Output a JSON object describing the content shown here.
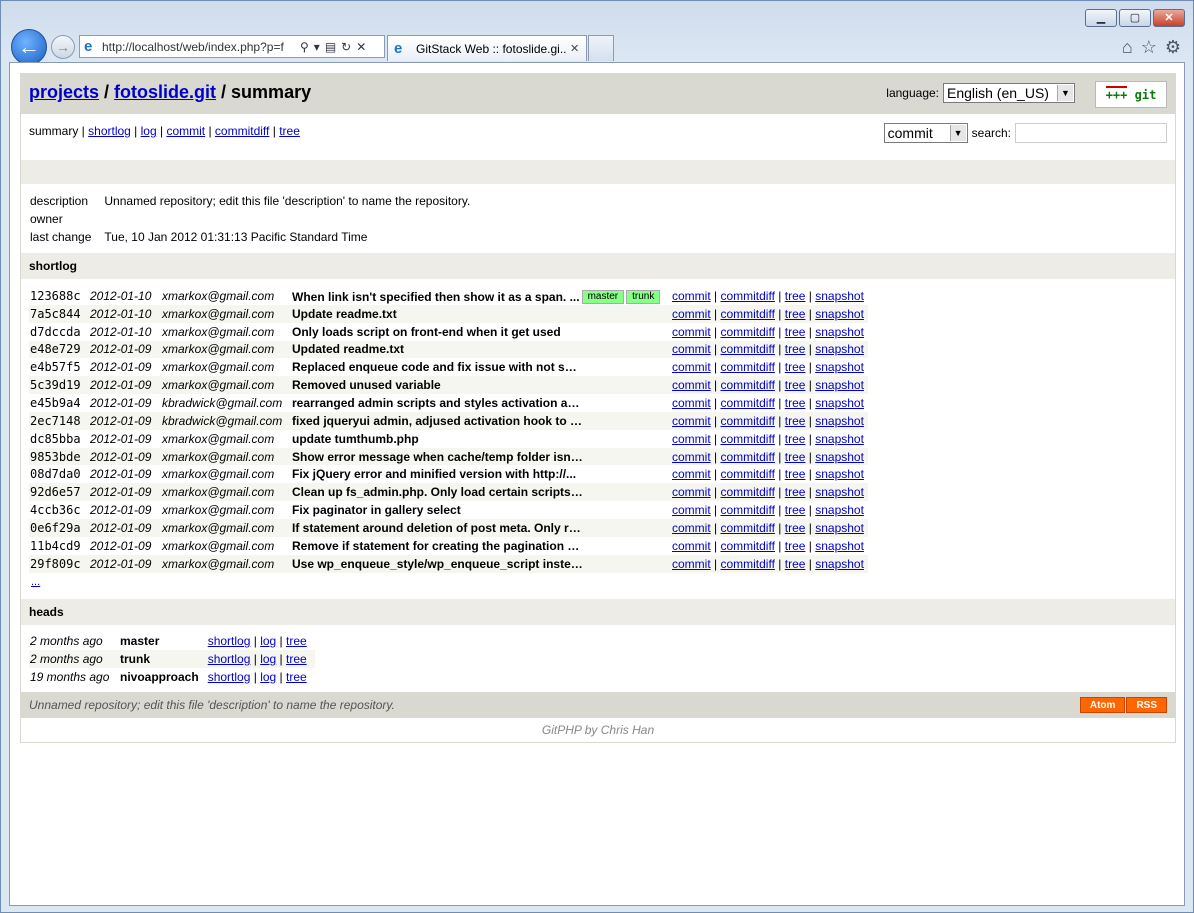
{
  "browser": {
    "address": "http://localhost/web/index.php?p=f",
    "tab_title": "GitStack Web :: fotoslide.gi...",
    "window_buttons": [
      "minimize-icon",
      "maximize-icon",
      "close-icon"
    ],
    "right_icons": [
      "home-icon",
      "star-icon",
      "gear-icon"
    ]
  },
  "header": {
    "crumb_projects": "projects",
    "sep1": " / ",
    "crumb_repo": "fotoslide.git",
    "sep2": " / summary",
    "language_label": "language:",
    "language_value": "English (en_US)",
    "logo_text_minus": "---",
    "logo_text_plus": "+++",
    "logo_word": " git"
  },
  "nav": {
    "current": "summary",
    "links": [
      "shortlog",
      "log",
      "commit",
      "commitdiff",
      "tree"
    ],
    "search_type": "commit",
    "search_label": "search:"
  },
  "project": {
    "description_label": "description",
    "description": "Unnamed repository; edit this file 'description' to name the repository.",
    "owner_label": "owner",
    "owner": "",
    "last_change_label": "last change",
    "last_change": "Tue, 10 Jan 2012 01:31:13 Pacific Standard Time"
  },
  "shortlog": {
    "title": "shortlog",
    "action_links": [
      "commit",
      "commitdiff",
      "tree",
      "snapshot"
    ],
    "rows": [
      {
        "hash": "123688c",
        "date": "2012-01-10",
        "author": "xmarkox@gmail.com",
        "message": "When link isn't specified then show it as a span. ...",
        "tags": [
          "master",
          "trunk"
        ]
      },
      {
        "hash": "7a5c844",
        "date": "2012-01-10",
        "author": "xmarkox@gmail.com",
        "message": "Update readme.txt",
        "tags": []
      },
      {
        "hash": "d7dccda",
        "date": "2012-01-10",
        "author": "xmarkox@gmail.com",
        "message": "Only loads script on front-end when it get used",
        "tags": []
      },
      {
        "hash": "e48e729",
        "date": "2012-01-09",
        "author": "xmarkox@gmail.com",
        "message": "Updated readme.txt",
        "tags": []
      },
      {
        "hash": "e4b57f5",
        "date": "2012-01-09",
        "author": "xmarkox@gmail.com",
        "message": "Replaced enqueue code and fix issue with not showi...",
        "tags": []
      },
      {
        "hash": "5c39d19",
        "date": "2012-01-09",
        "author": "xmarkox@gmail.com",
        "message": "Removed unused variable",
        "tags": []
      },
      {
        "hash": "e45b9a4",
        "date": "2012-01-09",
        "author": "kbradwick@gmail.com",
        "message": "rearranged admin scripts and styles activation act...",
        "tags": []
      },
      {
        "hash": "2ec7148",
        "date": "2012-01-09",
        "author": "kbradwick@gmail.com",
        "message": "fixed jqueryui admin, adjused activation hook to a...",
        "tags": []
      },
      {
        "hash": "dc85bba",
        "date": "2012-01-09",
        "author": "xmarkox@gmail.com",
        "message": "update tumthumb.php",
        "tags": []
      },
      {
        "hash": "9853bde",
        "date": "2012-01-09",
        "author": "xmarkox@gmail.com",
        "message": "Show error message when cache/temp folder isn't wr...",
        "tags": []
      },
      {
        "hash": "08d7da0",
        "date": "2012-01-09",
        "author": "xmarkox@gmail.com",
        "message": "Fix jQuery error and minified version with http://...",
        "tags": []
      },
      {
        "hash": "92d6e57",
        "date": "2012-01-09",
        "author": "xmarkox@gmail.com",
        "message": "Clean up fs_admin.php. Only load certain scripts o...",
        "tags": []
      },
      {
        "hash": "4ccb36c",
        "date": "2012-01-09",
        "author": "xmarkox@gmail.com",
        "message": "Fix paginator in gallery select",
        "tags": []
      },
      {
        "hash": "0e6f29a",
        "date": "2012-01-09",
        "author": "xmarkox@gmail.com",
        "message": "If statement around deletion of post meta. Only ru...",
        "tags": []
      },
      {
        "hash": "11b4cd9",
        "date": "2012-01-09",
        "author": "xmarkox@gmail.com",
        "message": "Remove if statement for creating the pagination ob...",
        "tags": []
      },
      {
        "hash": "29f809c",
        "date": "2012-01-09",
        "author": "xmarkox@gmail.com",
        "message": "Use wp_enqueue_style/wp_enqueue_script instead of ...",
        "tags": []
      }
    ],
    "more": "..."
  },
  "heads": {
    "title": "heads",
    "action_links": [
      "shortlog",
      "log",
      "tree"
    ],
    "rows": [
      {
        "age": "2 months ago",
        "name": "master"
      },
      {
        "age": "2 months ago",
        "name": "trunk"
      },
      {
        "age": "19 months ago",
        "name": "nivoapproach"
      }
    ]
  },
  "footer": {
    "description": "Unnamed repository; edit this file 'description' to name the repository.",
    "atom": "Atom",
    "rss": "RSS",
    "credit": "GitPHP by Chris Han"
  }
}
